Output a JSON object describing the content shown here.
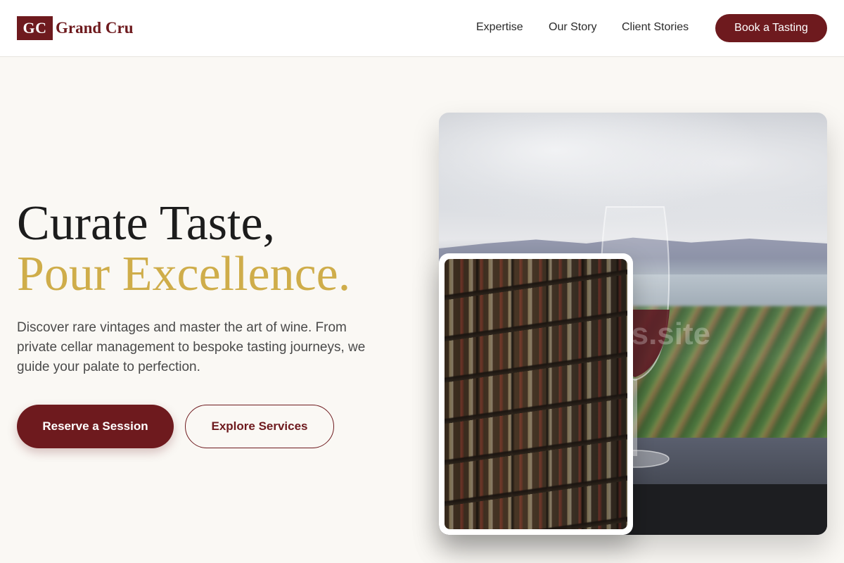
{
  "header": {
    "logo_mark": "GC",
    "logo_text": "Grand Cru",
    "nav": [
      {
        "label": "Expertise"
      },
      {
        "label": "Our Story"
      },
      {
        "label": "Client Stories"
      }
    ],
    "cta_label": "Book a Tasting"
  },
  "hero": {
    "title_line1": "Curate Taste,",
    "title_line2": "Pour Excellence.",
    "description": "Discover rare vintages and master the art of wine. From private cellar management to bespoke tasting journeys, we guide your palate to perfection.",
    "primary_button": "Reserve a Session",
    "secondary_button": "Explore Services"
  },
  "images": {
    "main_alt_watermark": "ers.site"
  },
  "colors": {
    "brand": "#6e1a1e",
    "accent_gold": "#cfad4a",
    "background": "#faf8f4"
  }
}
